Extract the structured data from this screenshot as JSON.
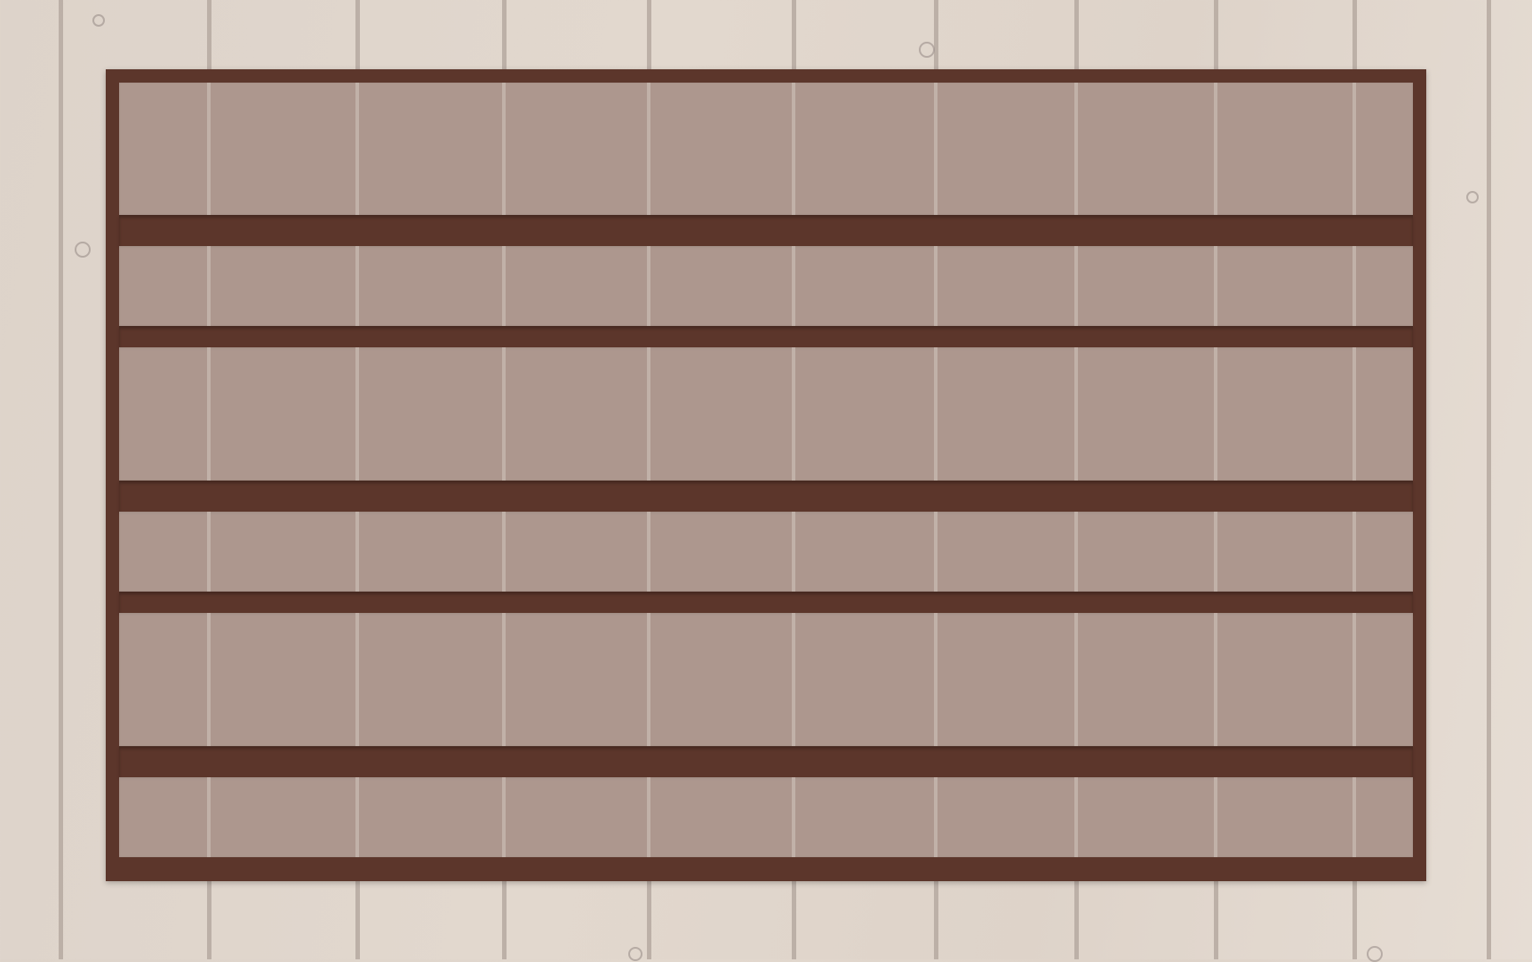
{
  "scene": {
    "type": "wooden-shelf-board",
    "shelf_count": 6,
    "colors": {
      "background_wood": "#ddd3ca",
      "frame": "#5c362b",
      "plank_line": "#b3a69d",
      "compartment": "#e8ded4"
    }
  }
}
